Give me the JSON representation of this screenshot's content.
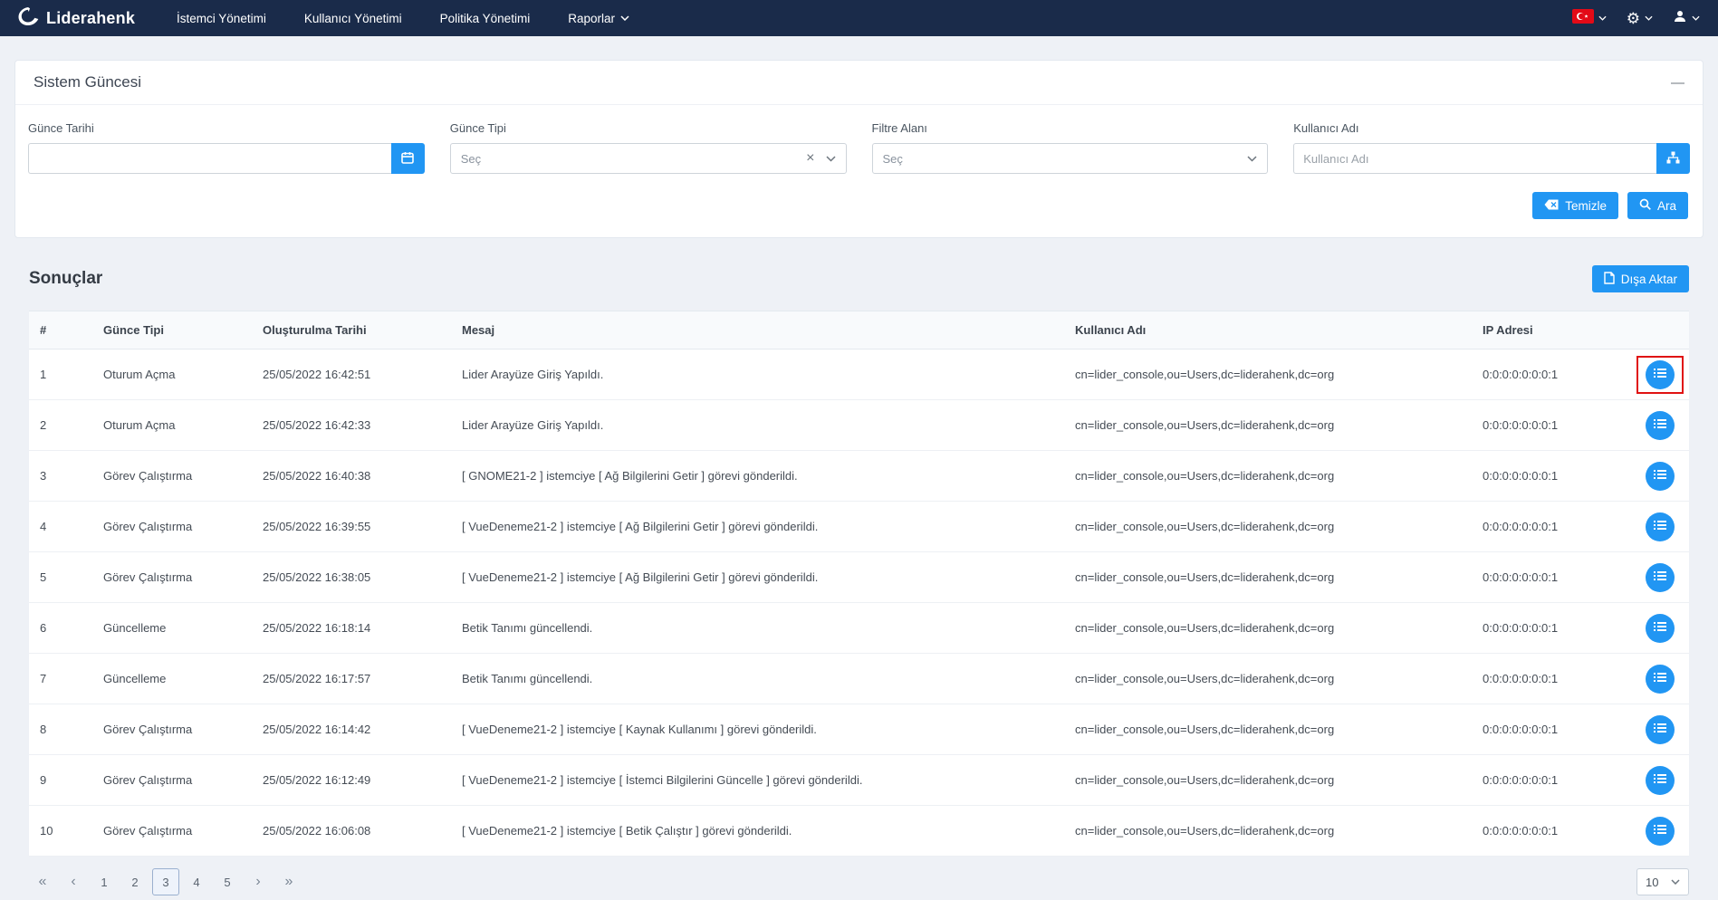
{
  "navbar": {
    "brand": "Liderahenk",
    "items": [
      {
        "label": "İstemci Yönetimi",
        "has_dropdown": false
      },
      {
        "label": "Kullanıcı Yönetimi",
        "has_dropdown": false
      },
      {
        "label": "Politika Yönetimi",
        "has_dropdown": false
      },
      {
        "label": "Raporlar",
        "has_dropdown": true
      }
    ]
  },
  "filter_panel": {
    "title": "Sistem Güncesi",
    "fields": {
      "date": {
        "label": "Günce Tarihi",
        "value": ""
      },
      "type": {
        "label": "Günce Tipi",
        "placeholder": "Seç"
      },
      "filter_area": {
        "label": "Filtre Alanı",
        "placeholder": "Seç"
      },
      "username": {
        "label": "Kullanıcı Adı",
        "placeholder": "Kullanıcı Adı"
      }
    },
    "actions": {
      "clear": "Temizle",
      "search": "Ara"
    }
  },
  "results": {
    "title": "Sonuçlar",
    "export_label": "Dışa Aktar",
    "table": {
      "columns": [
        "#",
        "Günce Tipi",
        "Oluşturulma Tarihi",
        "Mesaj",
        "Kullanıcı Adı",
        "IP Adresi"
      ],
      "rows": [
        {
          "no": "1",
          "type": "Oturum Açma",
          "date": "25/05/2022 16:42:51",
          "message": "Lider Arayüze Giriş Yapıldı.",
          "user": "cn=lider_console,ou=Users,dc=liderahenk,dc=org",
          "ip": "0:0:0:0:0:0:0:1",
          "highlighted": true
        },
        {
          "no": "2",
          "type": "Oturum Açma",
          "date": "25/05/2022 16:42:33",
          "message": "Lider Arayüze Giriş Yapıldı.",
          "user": "cn=lider_console,ou=Users,dc=liderahenk,dc=org",
          "ip": "0:0:0:0:0:0:0:1",
          "highlighted": false
        },
        {
          "no": "3",
          "type": "Görev Çalıştırma",
          "date": "25/05/2022 16:40:38",
          "message": "[ GNOME21-2 ] istemciye [ Ağ Bilgilerini Getir ] görevi gönderildi.",
          "user": "cn=lider_console,ou=Users,dc=liderahenk,dc=org",
          "ip": "0:0:0:0:0:0:0:1",
          "highlighted": false
        },
        {
          "no": "4",
          "type": "Görev Çalıştırma",
          "date": "25/05/2022 16:39:55",
          "message": "[ VueDeneme21-2 ] istemciye [ Ağ Bilgilerini Getir ] görevi gönderildi.",
          "user": "cn=lider_console,ou=Users,dc=liderahenk,dc=org",
          "ip": "0:0:0:0:0:0:0:1",
          "highlighted": false
        },
        {
          "no": "5",
          "type": "Görev Çalıştırma",
          "date": "25/05/2022 16:38:05",
          "message": "[ VueDeneme21-2 ] istemciye [ Ağ Bilgilerini Getir ] görevi gönderildi.",
          "user": "cn=lider_console,ou=Users,dc=liderahenk,dc=org",
          "ip": "0:0:0:0:0:0:0:1",
          "highlighted": false
        },
        {
          "no": "6",
          "type": "Güncelleme",
          "date": "25/05/2022 16:18:14",
          "message": "Betik Tanımı güncellendi.",
          "user": "cn=lider_console,ou=Users,dc=liderahenk,dc=org",
          "ip": "0:0:0:0:0:0:0:1",
          "highlighted": false
        },
        {
          "no": "7",
          "type": "Güncelleme",
          "date": "25/05/2022 16:17:57",
          "message": "Betik Tanımı güncellendi.",
          "user": "cn=lider_console,ou=Users,dc=liderahenk,dc=org",
          "ip": "0:0:0:0:0:0:0:1",
          "highlighted": false
        },
        {
          "no": "8",
          "type": "Görev Çalıştırma",
          "date": "25/05/2022 16:14:42",
          "message": "[ VueDeneme21-2 ] istemciye [ Kaynak Kullanımı ] görevi gönderildi.",
          "user": "cn=lider_console,ou=Users,dc=liderahenk,dc=org",
          "ip": "0:0:0:0:0:0:0:1",
          "highlighted": false
        },
        {
          "no": "9",
          "type": "Görev Çalıştırma",
          "date": "25/05/2022 16:12:49",
          "message": "[ VueDeneme21-2 ] istemciye [ İstemci Bilgilerini Güncelle ] görevi gönderildi.",
          "user": "cn=lider_console,ou=Users,dc=liderahenk,dc=org",
          "ip": "0:0:0:0:0:0:0:1",
          "highlighted": false
        },
        {
          "no": "10",
          "type": "Görev Çalıştırma",
          "date": "25/05/2022 16:06:08",
          "message": "[ VueDeneme21-2 ] istemciye [ Betik Çalıştır ] görevi gönderildi.",
          "user": "cn=lider_console,ou=Users,dc=liderahenk,dc=org",
          "ip": "0:0:0:0:0:0:0:1",
          "highlighted": false
        }
      ]
    }
  },
  "pagination": {
    "pages": [
      "1",
      "2",
      "3",
      "4",
      "5"
    ],
    "active": "3",
    "page_size": "10",
    "icons": {
      "first": "«",
      "prev": "‹",
      "next": "›",
      "last": "»"
    }
  },
  "icons": {
    "collapse_minus": "—",
    "clear_x": "×",
    "gear": "⚙"
  },
  "colors": {
    "accent": "#2196f3",
    "navbar_bg": "#1a2b4a",
    "page_bg": "#eef1f6",
    "highlight_box": "#e01212",
    "flag_red": "#e30a17"
  }
}
